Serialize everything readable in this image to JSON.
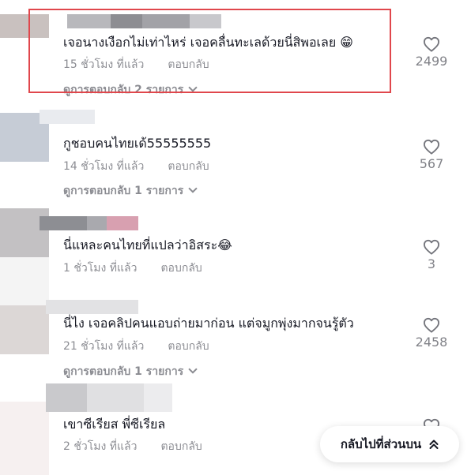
{
  "colors": {
    "text_primary": "#161823",
    "text_secondary": "rgba(22,24,35,0.5)",
    "highlight_border": "#e0474c"
  },
  "comments": [
    {
      "text": "เจอนางเงือกไม่เท่าไหร่ เจอคลื่นทะเลด้วยนี่สิพอเลย 😁",
      "time": "15 ชั่วโมง ที่แล้ว",
      "reply_label": "ตอบกลับ",
      "view_replies": "ดูการตอบกลับ 2 รายการ",
      "likes": "2499",
      "like_icon": "heart-outline-icon"
    },
    {
      "text": "กูชอบคนไทยเด้55555555",
      "time": "14 ชั่วโมง ที่แล้ว",
      "reply_label": "ตอบกลับ",
      "view_replies": "ดูการตอบกลับ 1 รายการ",
      "likes": "567",
      "like_icon": "heart-outline-icon"
    },
    {
      "text": "นี่แหละคนไทยที่แปลว่าอิสระ😂",
      "time": "1 ชั่วโมง ที่แล้ว",
      "reply_label": "ตอบกลับ",
      "likes": "3",
      "like_icon": "heart-outline-icon"
    },
    {
      "text": "นี่ไง เจอคลิปคนแอบถ่ายมาก่อน แต่จมูกพุ่งมากจนรู้ตัว",
      "time": "21 ชั่วโมง ที่แล้ว",
      "reply_label": "ตอบกลับ",
      "view_replies": "ดูการตอบกลับ 1 รายการ",
      "likes": "2458",
      "like_icon": "heart-outline-icon"
    },
    {
      "text": "เขาซีเรียส พี่ซีเรียล",
      "time": "2 ชั่วโมง ที่แล้ว",
      "reply_label": "ตอบกลับ",
      "like_icon": "heart-outline-icon"
    }
  ],
  "back_to_top": {
    "label": "กลับไปที่ส่วนบน",
    "icon": "double-chevron-up-icon"
  }
}
